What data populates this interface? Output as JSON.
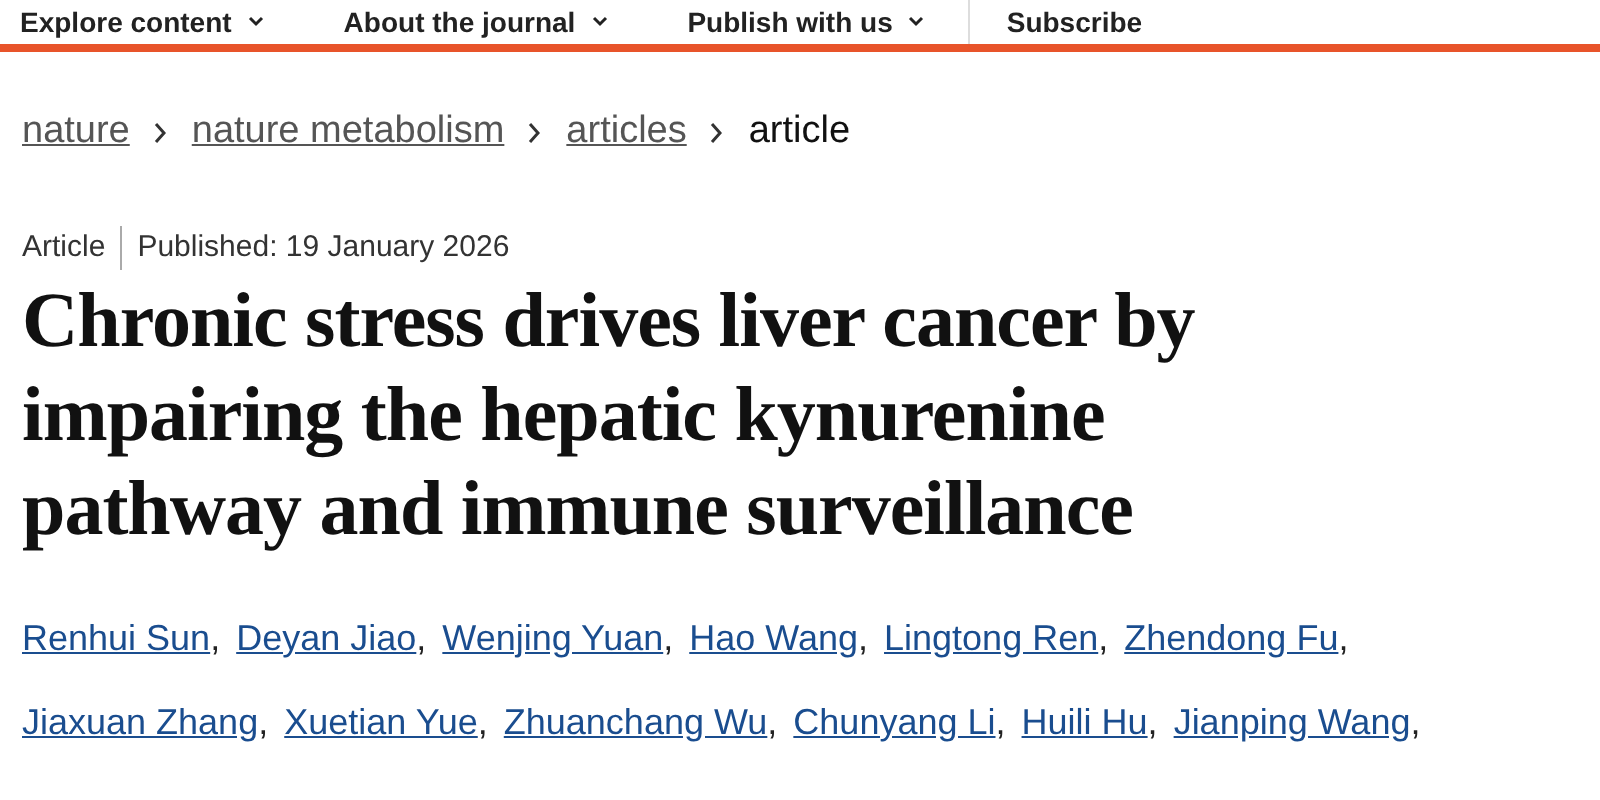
{
  "nav": [
    {
      "label": "Explore content",
      "caret": true
    },
    {
      "label": "About the journal",
      "caret": true
    },
    {
      "label": "Publish with us",
      "caret": true
    },
    {
      "label": "Subscribe",
      "caret": false
    }
  ],
  "breadcrumb": [
    {
      "label": "nature",
      "link": true
    },
    {
      "label": "nature metabolism",
      "link": true
    },
    {
      "label": "articles",
      "link": true
    },
    {
      "label": "article",
      "link": false
    }
  ],
  "article": {
    "type": "Article",
    "published": "Published: 19 January 2026",
    "title": "Chronic stress drives liver cancer by impairing the hepatic kynurenine pathway and immune surveillance",
    "authors": [
      {
        "name": "Renhui Sun",
        "separator": ","
      },
      {
        "name": "Deyan Jiao",
        "separator": ","
      },
      {
        "name": "Wenjing Yuan",
        "separator": ","
      },
      {
        "name": "Hao Wang",
        "separator": ","
      },
      {
        "name": "Lingtong Ren",
        "separator": ","
      },
      {
        "name": "Zhendong Fu",
        "separator": ","
      },
      {
        "name": "Jiaxuan Zhang",
        "separator": ","
      },
      {
        "name": "Xuetian Yue",
        "separator": ","
      },
      {
        "name": "Zhuanchang Wu",
        "separator": ","
      },
      {
        "name": "Chunyang Li",
        "separator": ","
      },
      {
        "name": "Huili Hu",
        "separator": ","
      },
      {
        "name": "Jianping Wang",
        "separator": ","
      }
    ]
  }
}
